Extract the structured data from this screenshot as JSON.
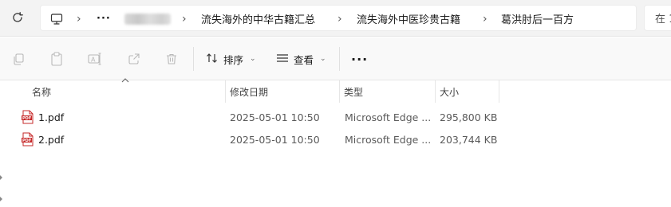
{
  "address_bar": {
    "more_glyph": "···",
    "blurred_segment": "",
    "crumbs": [
      "流失海外的中华古籍汇总",
      "流失海外中医珍贵古籍",
      "葛洪肘后一百方"
    ],
    "search_placeholder": "在 1"
  },
  "command_bar": {
    "sort_label": "排序",
    "view_label": "查看",
    "more_label": "···"
  },
  "columns": {
    "name": "名称",
    "modified": "修改日期",
    "type": "类型",
    "size": "大小"
  },
  "files": [
    {
      "name": "1.pdf",
      "modified": "2025-05-01 10:50",
      "type": "Microsoft Edge ...",
      "size": "295,800 KB"
    },
    {
      "name": "2.pdf",
      "modified": "2025-05-01 10:50",
      "type": "Microsoft Edge ...",
      "size": "203,744 KB"
    }
  ],
  "colors": {
    "pdf_icon": "#c62828",
    "icon_disabled": "#b9b9b9"
  }
}
